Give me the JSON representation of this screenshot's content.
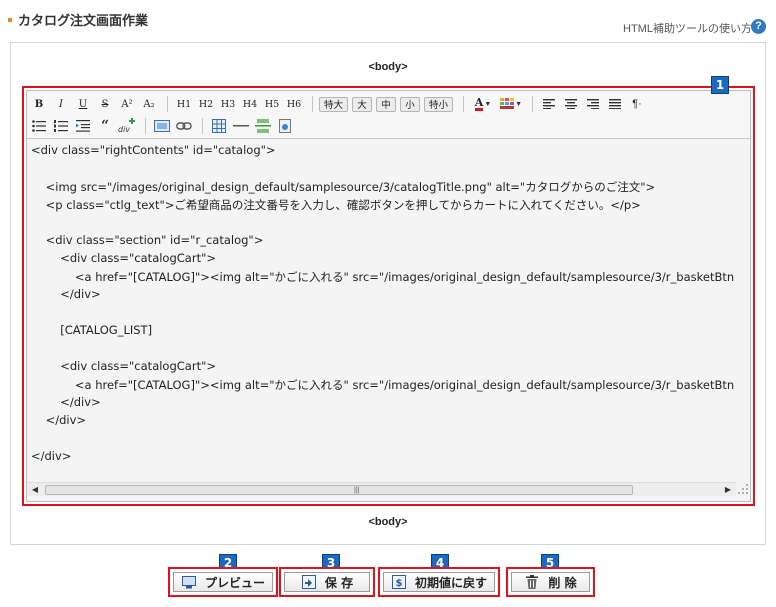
{
  "header": {
    "title": "カタログ注文画面作業",
    "help_label": "HTML補助ツールの使い方",
    "help_icon": "?"
  },
  "body_tag_top": "<body>",
  "body_tag_bottom": "<body>",
  "toolbar": {
    "format_buttons": [
      "B",
      "I",
      "U",
      "S",
      "A²",
      "A₂"
    ],
    "heading_buttons": [
      "H1",
      "H2",
      "H3",
      "H4",
      "H5",
      "H6"
    ],
    "size_buttons": [
      "特大",
      "大",
      "中",
      "小",
      "特小"
    ],
    "font_color_label": "A"
  },
  "code_lines": [
    "<div class=\"rightContents\" id=\"catalog\">",
    "",
    "    <img src=\"/images/original_design_default/samplesource/3/catalogTitle.png\" alt=\"カタログからのご注文\">",
    "    <p class=\"ctlg_text\">ご希望商品の注文番号を入力し、確認ボタンを押してからカートに入れてください。</p>",
    "",
    "    <div class=\"section\" id=\"r_catalog\">",
    "        <div class=\"catalogCart\">",
    "            <a href=\"[CATALOG]\"><img alt=\"かごに入れる\" src=\"/images/original_design_default/samplesource/3/r_basketBtn",
    "        </div>",
    "",
    "        [CATALOG_LIST]",
    "",
    "        <div class=\"catalogCart\">",
    "            <a href=\"[CATALOG]\"><img alt=\"かごに入れる\" src=\"/images/original_design_default/samplesource/3/r_basketBtn",
    "        </div>",
    "    </div>",
    "",
    "</div>"
  ],
  "badges": [
    "1",
    "2",
    "3",
    "4",
    "5"
  ],
  "actions": {
    "preview": "プレビュー",
    "save": "保 存",
    "reset": "初期値に戻す",
    "delete": "削 除"
  },
  "colors": {
    "accent_red": "#e0121b",
    "badge_blue": "#1b6ac1",
    "bullet_orange": "#e8881a",
    "help_blue": "#2f79c7"
  }
}
